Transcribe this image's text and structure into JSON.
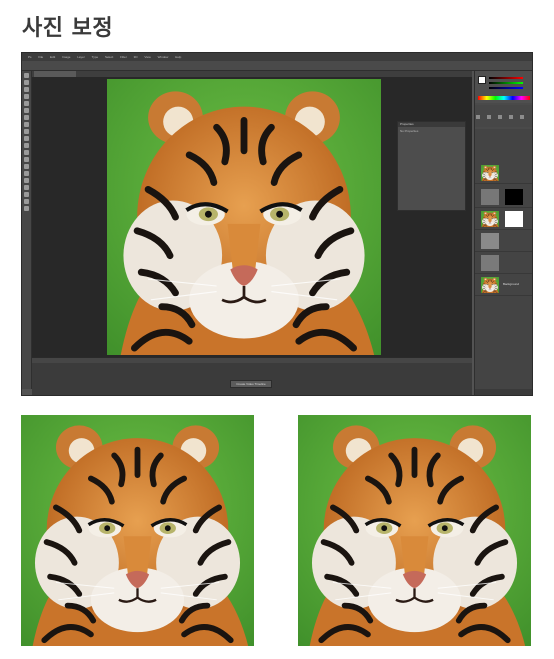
{
  "page": {
    "title": "사진 보정"
  },
  "photoshop": {
    "menu": [
      "Ps",
      "File",
      "Edit",
      "Image",
      "Layer",
      "Type",
      "Select",
      "Filter",
      "3D",
      "View",
      "Window",
      "Help"
    ],
    "properties_panel": {
      "header": "Properties",
      "text": "No Properties"
    },
    "timeline": {
      "button": "Create Video Timeline"
    },
    "layers": {
      "background_label": "Background"
    }
  },
  "icons": {
    "tool_icons": "toolbox-icons",
    "adjustment_icons": "adjustment-icons"
  },
  "colors": {
    "title_text": "#3a3a3a",
    "ps_bg": "#535353",
    "canvas_bg": "#282828",
    "grass": "#5aa83a"
  }
}
